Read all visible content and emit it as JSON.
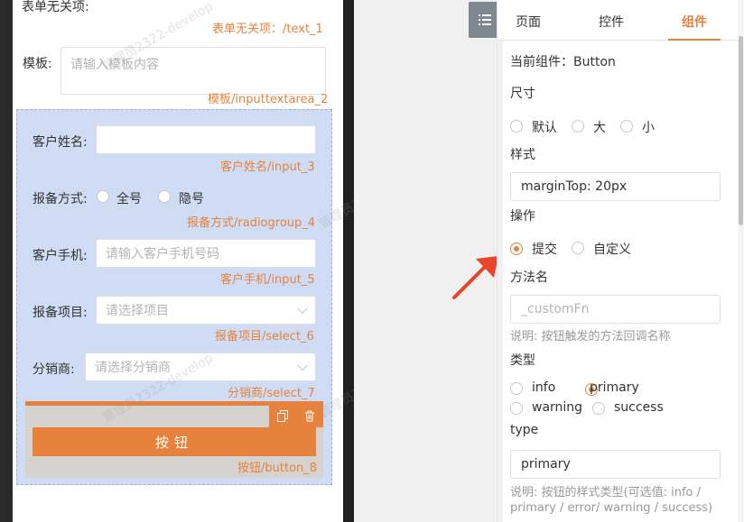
{
  "form": {
    "irrelevant_label": "表单无关项:",
    "irrelevant_tag": "表单无关项：/text_1",
    "template_label": "模板:",
    "template_placeholder": "请输入模板内容",
    "template_tag": "模板/inputtextarea_2",
    "customer_name_label": "客户姓名:",
    "customer_name_tag": "客户姓名/input_3",
    "report_method_label": "报备方式:",
    "report_method_options": [
      "全号",
      "隐号"
    ],
    "report_method_tag": "报备方式/radiogroup_4",
    "customer_phone_label": "客户手机:",
    "customer_phone_placeholder": "请输入客户手机号码",
    "customer_phone_tag": "客户手机/input_5",
    "report_item_label": "报备项目:",
    "report_item_placeholder": "请选择项目",
    "report_item_tag": "报备项目/select_6",
    "distributor_label": "分销商:",
    "distributor_placeholder": "请选择分销商",
    "distributor_tag": "分销商/select_7",
    "button_label": "按钮",
    "button_tag": "按钮/button_8"
  },
  "watermark": "管理员2322-develop",
  "panel": {
    "tabs": [
      "页面",
      "控件",
      "组件"
    ],
    "active_tab": "组件",
    "current_component": "当前组件：Button",
    "size_label": "尺寸",
    "size_options": [
      "默认",
      "大",
      "小"
    ],
    "style_label": "样式",
    "style_value": "marginTop: 20px",
    "action_label": "操作",
    "action_options": [
      "提交",
      "自定义"
    ],
    "action_selected": "提交",
    "method_label": "方法名",
    "method_placeholder": "_customFn",
    "method_hint": "说明: 按钮触发的方法回调名称",
    "kind_label": "类型",
    "kind_options": [
      "info",
      "primary",
      "warning",
      "success"
    ],
    "kind_selected": "primary",
    "type_label": "type",
    "type_value": "primary",
    "type_hint_line1": "说明: 按钮的样式类型(可选值: info /",
    "type_hint_line2": "primary / error/ warning / success)"
  },
  "colors": {
    "accent": "#e6823c",
    "selection": "#cfdcf3",
    "arrow": "#e8452c"
  },
  "icons": {
    "toggle": "list-icon",
    "copy": "copy-icon",
    "delete": "trash-icon"
  }
}
